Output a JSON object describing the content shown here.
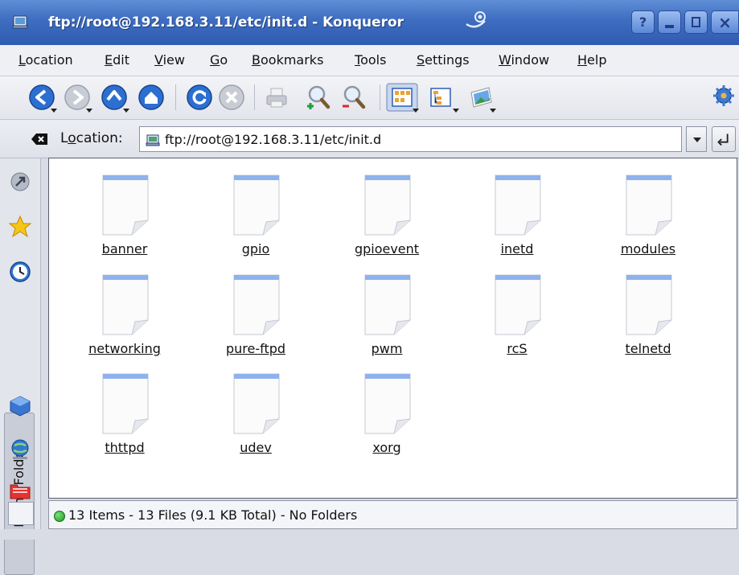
{
  "window": {
    "title": "ftp://root@192.168.3.11/etc/init.d - Konqueror",
    "help_button": "?"
  },
  "menu": {
    "items": [
      {
        "label": "Location",
        "accel": "L",
        "rest": "ocation"
      },
      {
        "label": "Edit",
        "accel": "E",
        "rest": "dit"
      },
      {
        "label": "View",
        "accel": "V",
        "rest": "iew"
      },
      {
        "label": "Go",
        "accel": "G",
        "rest": "o"
      },
      {
        "label": "Bookmarks",
        "accel": "B",
        "rest": "ookmarks"
      },
      {
        "label": "Tools",
        "accel": "T",
        "rest": "ools"
      },
      {
        "label": "Settings",
        "accel": "S",
        "rest": "ettings"
      },
      {
        "label": "Window",
        "accel": "W",
        "rest": "indow"
      },
      {
        "label": "Help",
        "accel": "H",
        "rest": "elp"
      }
    ]
  },
  "toolbar": {
    "buttons": [
      "back-icon",
      "forward-icon",
      "up-icon",
      "home-icon",
      "reload-icon",
      "stop-icon",
      "print-icon",
      "zoom-in-icon",
      "zoom-out-icon",
      "icon-view-icon",
      "tree-view-icon",
      "image-viewer-icon",
      "configure-icon"
    ]
  },
  "location": {
    "label_accel": "o",
    "label_pre": "L",
    "label_post": "cation:",
    "url": "ftp://root@192.168.3.11/etc/init.d"
  },
  "sidebar": {
    "tab_label": "Home Folder"
  },
  "files": [
    {
      "name": "banner"
    },
    {
      "name": "gpio"
    },
    {
      "name": "gpioevent"
    },
    {
      "name": "inetd"
    },
    {
      "name": "modules"
    },
    {
      "name": "networking"
    },
    {
      "name": "pure-ftpd"
    },
    {
      "name": "pwm"
    },
    {
      "name": "rcS"
    },
    {
      "name": "telnetd"
    },
    {
      "name": "thttpd"
    },
    {
      "name": "udev"
    },
    {
      "name": "xorg"
    }
  ],
  "status": {
    "text": "13 Items - 13 Files (9.1 KB Total) - No Folders"
  },
  "colors": {
    "titlebar": "#3d6cc0",
    "status_led": "#1a9a27"
  }
}
